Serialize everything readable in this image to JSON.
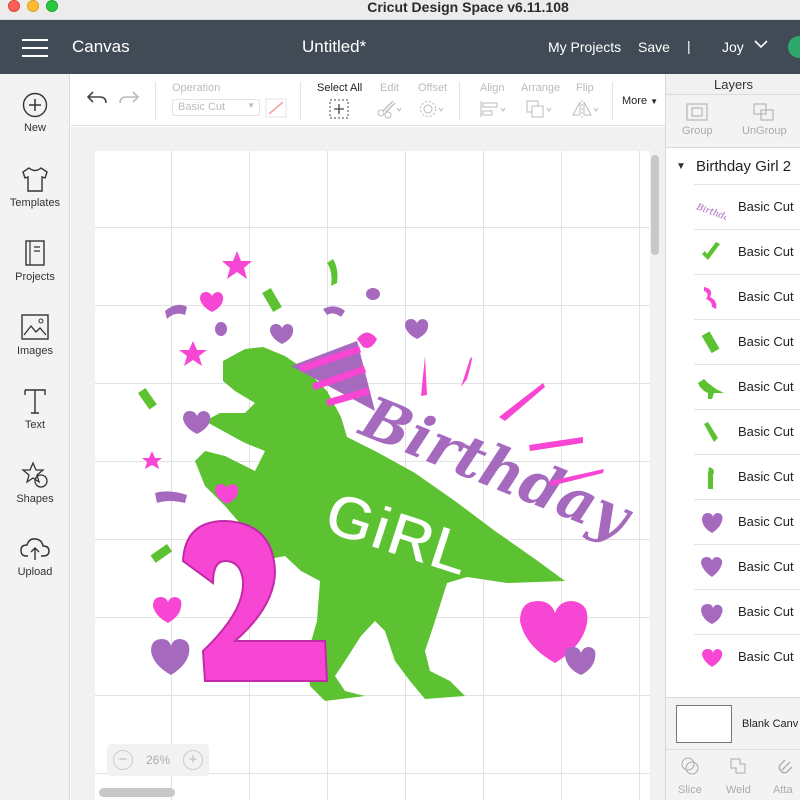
{
  "window": {
    "title": "Cricut Design Space  v6.11.108"
  },
  "header": {
    "canvas_label": "Canvas",
    "doc_title": "Untitled*",
    "my_projects": "My Projects",
    "save": "Save",
    "separator": "|",
    "user": "Joy",
    "chevron": "⌵"
  },
  "sidebar": {
    "items": [
      {
        "label": "New",
        "icon": "plus-circle-icon"
      },
      {
        "label": "Templates",
        "icon": "shirt-icon"
      },
      {
        "label": "Projects",
        "icon": "book-icon"
      },
      {
        "label": "Images",
        "icon": "image-icon"
      },
      {
        "label": "Text",
        "icon": "text-icon"
      },
      {
        "label": "Shapes",
        "icon": "shapes-icon"
      },
      {
        "label": "Upload",
        "icon": "cloud-upload-icon"
      }
    ]
  },
  "toolbar": {
    "operation_label": "Operation",
    "operation_value": "Basic Cut",
    "select_all": "Select All",
    "edit": "Edit",
    "offset": "Offset",
    "align": "Align",
    "arrange": "Arrange",
    "flip": "Flip",
    "more": "More"
  },
  "canvas": {
    "zoom": "26%",
    "design": {
      "texts": [
        "Birthday",
        "GiRL",
        "2"
      ],
      "colors": {
        "green": "#5cc232",
        "purple": "#a569bd",
        "pink": "#f746d3"
      }
    }
  },
  "layers": {
    "title": "Layers",
    "group_label": "Group",
    "ungroup_label": "UnGroup",
    "group_name": "Birthday Girl 2",
    "rows": [
      {
        "name": "Basic Cut",
        "thumb": "birthday-text-thumb"
      },
      {
        "name": "Basic Cut",
        "thumb": "green-confetti-thumb"
      },
      {
        "name": "Basic Cut",
        "thumb": "pink-ribbon-thumb"
      },
      {
        "name": "Basic Cut",
        "thumb": "green-rect-thumb"
      },
      {
        "name": "Basic Cut",
        "thumb": "dino-thumb"
      },
      {
        "name": "Basic Cut",
        "thumb": "green-confetti-thumb"
      },
      {
        "name": "Basic Cut",
        "thumb": "green-curl-thumb"
      },
      {
        "name": "Basic Cut",
        "thumb": "purple-heart-thumb"
      },
      {
        "name": "Basic Cut",
        "thumb": "purple-heart-thumb"
      },
      {
        "name": "Basic Cut",
        "thumb": "purple-heart-thumb"
      },
      {
        "name": "Basic Cut",
        "thumb": "pink-heart-thumb"
      }
    ],
    "blank_canvas": "Blank Canv",
    "bottom_tools": [
      "Slice",
      "Weld",
      "Atta"
    ]
  }
}
